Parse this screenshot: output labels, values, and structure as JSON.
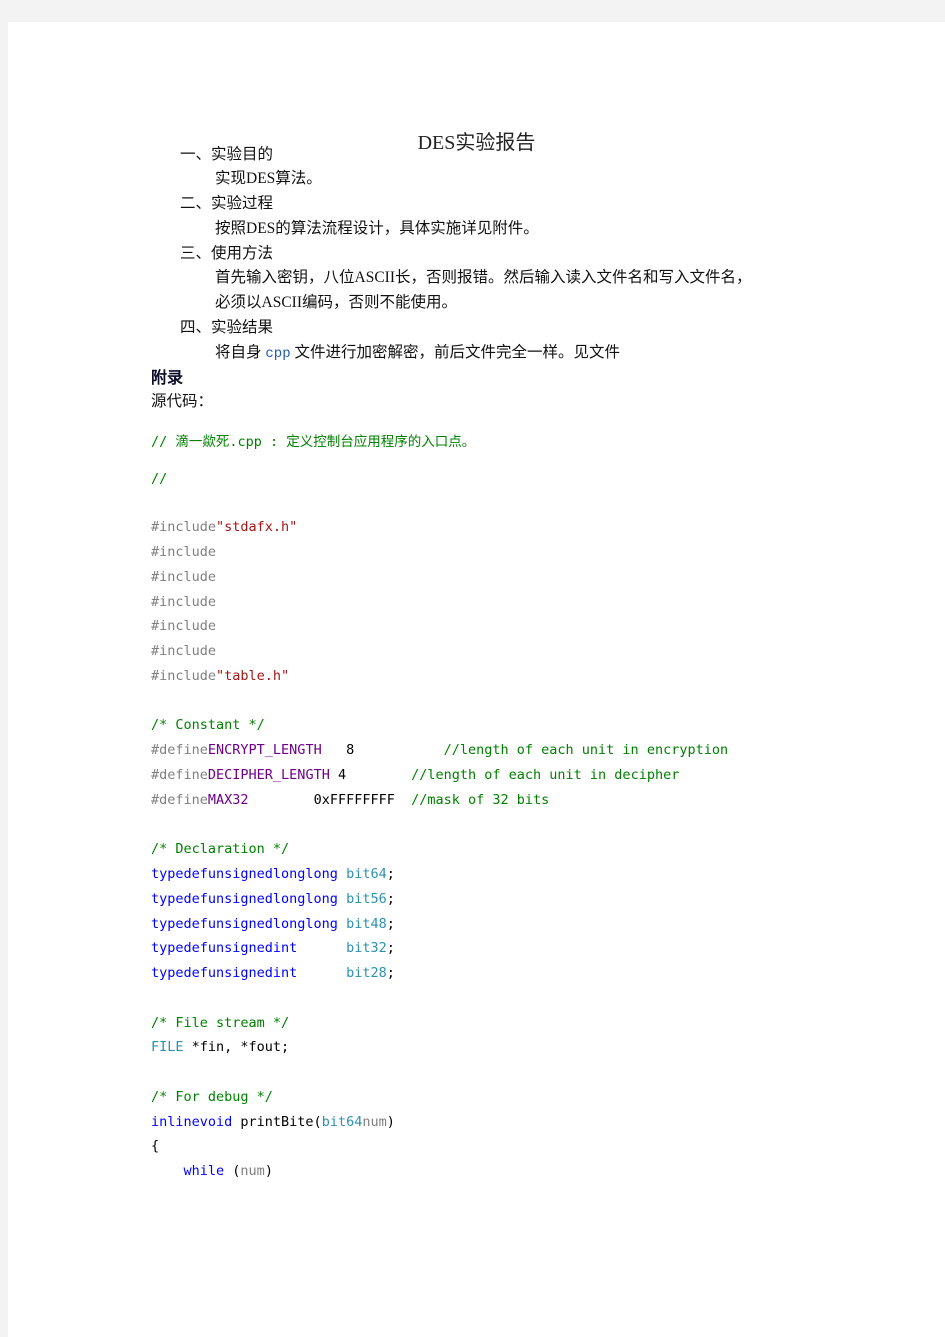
{
  "document": {
    "title": "DES实验报告",
    "sections": [
      {
        "heading": "一、实验目的",
        "lines": [
          "实现DES算法。"
        ]
      },
      {
        "heading": "二、实验过程",
        "lines": [
          "按照DES的算法流程设计，具体实施详见附件。"
        ]
      },
      {
        "heading": "三、使用方法",
        "lines": [
          "首先输入密钥，八位ASCII长，否则报错。然后输入读入文件名和写入文件名，",
          "必须以ASCII编码，否则不能使用。"
        ]
      },
      {
        "heading": "四、实验结果",
        "lines_parts": [
          "将自身",
          "cpp",
          "文件进行加密解密，前后文件完全一样。见文件"
        ]
      }
    ],
    "appendix_label": "附录",
    "source_label": "源代码："
  },
  "code": {
    "comment_header": "// 滴一歘死.cpp : 定义控制台应用程序的入口点。",
    "comment_empty": "//",
    "includes": [
      {
        "directive": "#include",
        "target": "\"stdafx.h\""
      },
      {
        "directive": "#include",
        "target": ""
      },
      {
        "directive": "#include",
        "target": ""
      },
      {
        "directive": "#include",
        "target": ""
      },
      {
        "directive": "#include",
        "target": ""
      },
      {
        "directive": "#include",
        "target": ""
      },
      {
        "directive": "#include",
        "target": "\"table.h\""
      }
    ],
    "constant_comment": "/* Constant */",
    "defines": [
      {
        "directive": "#define",
        "name": "ENCRYPT_LENGTH",
        "value": "   8",
        "comment": "           //length of each unit in encryption"
      },
      {
        "directive": "#define",
        "name": "DECIPHER_LENGTH",
        "value": " 4",
        "comment": "        //length of each unit in decipher"
      },
      {
        "directive": "#define",
        "name": "MAX32",
        "value": "        0xFFFFFFFF",
        "comment": "  //mask of 32 bits"
      }
    ],
    "declaration_comment": "/* Declaration */",
    "typedefs": [
      {
        "kw": "typedefunsignedlonglong",
        "pad": " ",
        "type": "bit64",
        "end": ";"
      },
      {
        "kw": "typedefunsignedlonglong",
        "pad": " ",
        "type": "bit56",
        "end": ";"
      },
      {
        "kw": "typedefunsignedlonglong",
        "pad": " ",
        "type": "bit48",
        "end": ";"
      },
      {
        "kw": "typedefunsignedint",
        "pad": "      ",
        "type": "bit32",
        "end": ";"
      },
      {
        "kw": "typedefunsignedint",
        "pad": "      ",
        "type": "bit28",
        "end": ";"
      }
    ],
    "filestream_comment": "/* File stream */",
    "file_decl": {
      "type": "FILE",
      "rest": " *fin, *fout;"
    },
    "debug_comment": "/* For debug */",
    "func_sig": {
      "kw": "inlinevoid",
      "name": " printBite(",
      "ptype": "bit64",
      "pname": "num",
      "close": ")"
    },
    "open_brace": "{",
    "while_line": {
      "indent": "    ",
      "kw": "while",
      "open": " (",
      "arg": "num",
      "close": ")"
    }
  }
}
